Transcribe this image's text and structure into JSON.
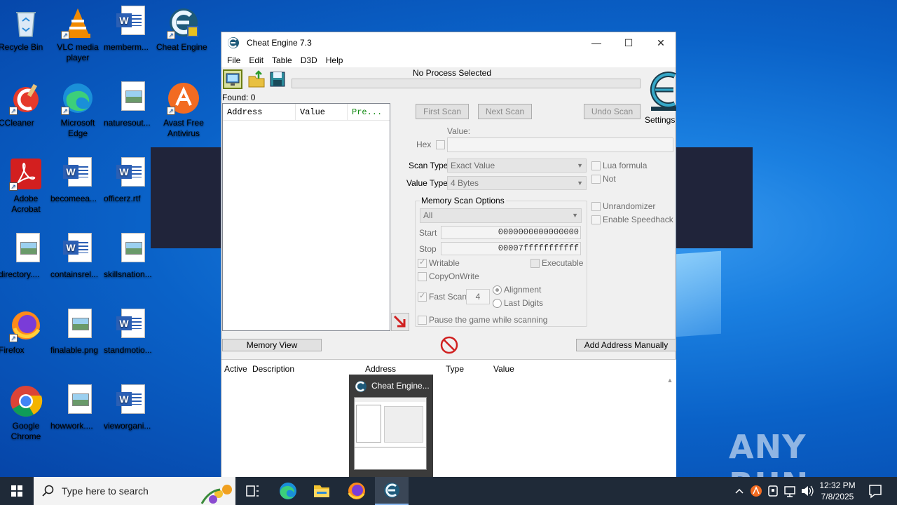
{
  "desktop": {
    "icons": [
      {
        "label": "Recycle Bin"
      },
      {
        "label": "VLC media player"
      },
      {
        "label": "memberm..."
      },
      {
        "label": "Cheat Engine"
      },
      {
        "label": "CCleaner"
      },
      {
        "label": "Microsoft Edge"
      },
      {
        "label": "naturesout..."
      },
      {
        "label": "Avast Free Antivirus"
      },
      {
        "label": "Adobe Acrobat"
      },
      {
        "label": "becomeea..."
      },
      {
        "label": "officerz.rtf"
      },
      {
        "label": "directory...."
      },
      {
        "label": "containsrel..."
      },
      {
        "label": "skillsnation..."
      },
      {
        "label": "Firefox"
      },
      {
        "label": "finalable.png"
      },
      {
        "label": "standmotio..."
      },
      {
        "label": "Google Chrome"
      },
      {
        "label": "howwork...."
      },
      {
        "label": "vieworgani..."
      }
    ],
    "watermark": "ANY RUN"
  },
  "window": {
    "title": "Cheat Engine 7.3",
    "menu": [
      "File",
      "Edit",
      "Table",
      "D3D",
      "Help"
    ],
    "process_title": "No Process Selected",
    "found_label": "Found: 0",
    "list_headers": {
      "address": "Address",
      "value": "Value",
      "previous": "Pre..."
    },
    "buttons": {
      "first_scan": "First Scan",
      "next_scan": "Next Scan",
      "undo_scan": "Undo Scan",
      "settings": "Settings",
      "memory_view": "Memory View",
      "add_address": "Add Address Manually"
    },
    "scan": {
      "value_label": "Value:",
      "hex_label": "Hex",
      "scan_type_label": "Scan Type",
      "scan_type_value": "Exact Value",
      "value_type_label": "Value Type",
      "value_type_value": "4 Bytes",
      "lua_formula": "Lua formula",
      "not_label": "Not",
      "unrandomizer": "Unrandomizer",
      "speedhack": "Enable Speedhack"
    },
    "memory_options": {
      "title": "Memory Scan Options",
      "region": "All",
      "start_label": "Start",
      "start_value": "0000000000000000",
      "stop_label": "Stop",
      "stop_value": "00007fffffffffff",
      "writable": "Writable",
      "executable": "Executable",
      "copy_on_write": "CopyOnWrite",
      "fast_scan": "Fast Scan",
      "fast_scan_value": "4",
      "alignment": "Alignment",
      "last_digits": "Last Digits",
      "pause_game": "Pause the game while scanning"
    },
    "table_headers": {
      "active": "Active",
      "description": "Description",
      "address": "Address",
      "type": "Type",
      "value": "Value"
    }
  },
  "thumbnail": {
    "title": "Cheat Engine..."
  },
  "taskbar": {
    "search_placeholder": "Type here to search",
    "time": "12:32 PM",
    "date": "7/8/2025"
  }
}
